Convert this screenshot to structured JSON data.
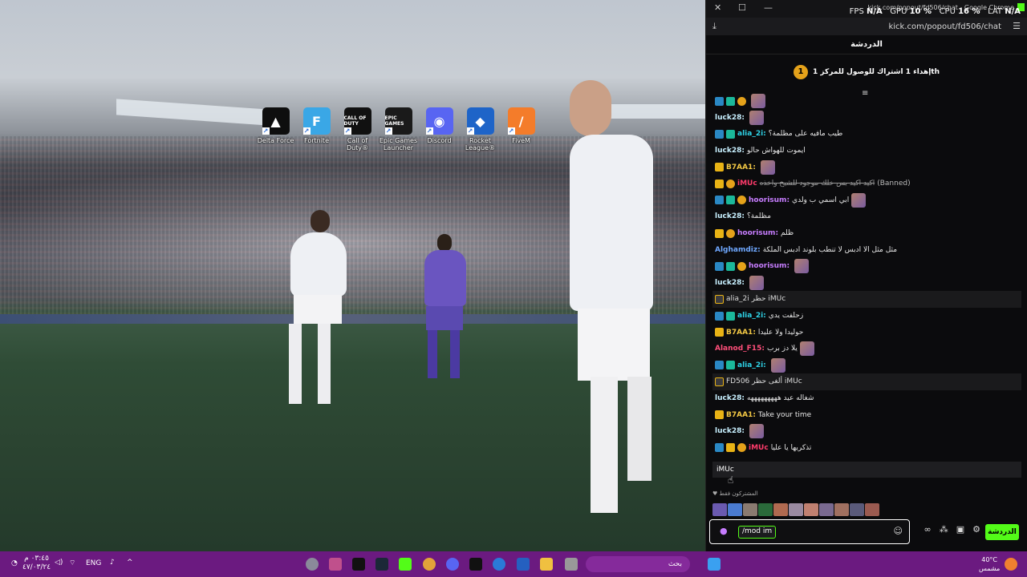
{
  "desktop": {
    "icons": [
      {
        "label": "Delta Force",
        "icon": "delta-force-icon",
        "color": "#0e0e0e",
        "text": "▲"
      },
      {
        "label": "Fortnite",
        "icon": "fortnite-icon",
        "color": "#3aa7e6",
        "text": "F"
      },
      {
        "label": "Call of Duty®",
        "icon": "call-of-duty-icon",
        "color": "#111111",
        "text": "CALL OF DUTY"
      },
      {
        "label": "Epic Games Launcher",
        "icon": "epic-games-icon",
        "color": "#1a1a1a",
        "text": "EPIC GAMES"
      },
      {
        "label": "Discord",
        "icon": "discord-icon",
        "color": "#5865f2",
        "text": "◉"
      },
      {
        "label": "Rocket League®",
        "icon": "rocket-league-icon",
        "color": "#1e64c8",
        "text": "◆"
      },
      {
        "label": "FiveM",
        "icon": "fivem-icon",
        "color": "#f47c2a",
        "text": "/"
      }
    ]
  },
  "browser": {
    "title": "kick.com/popout/fd506/chat - Google Chrome",
    "url": "kick.com/popout/fd506/chat",
    "overlay": {
      "fps_label": "FPS",
      "fps": "N/A",
      "gpu_label": "GPU",
      "gpu": "10 %",
      "cpu_label": "CPU",
      "cpu": "16 %",
      "lat_label": "LAT",
      "lat": "N/A"
    }
  },
  "chat": {
    "header": "الدردشة",
    "pinned": "إهداء 1 اشتراك للوصول للمركز 1th",
    "pinned_badge": "1",
    "messages": [
      {
        "badges": [
          "sub",
          "vip",
          "coin"
        ],
        "user": "",
        "color": "#e8e8e8",
        "text": "",
        "emote": true
      },
      {
        "badges": [],
        "user": "luck28:",
        "color": "#c8f0ff",
        "text": "",
        "emote": true
      },
      {
        "badges": [
          "sub",
          "vip"
        ],
        "user": "alia_2i:",
        "color": "#2ed2e6",
        "text": "طيب مافيه على مظلمة؟"
      },
      {
        "badges": [],
        "user": "luck28:",
        "color": "#c8f0ff",
        "text": "ايموت للهواش حالو"
      },
      {
        "badges": [
          "crown"
        ],
        "user": "B7AA1:",
        "color": "#f2c744",
        "text": "",
        "emote": true
      },
      {
        "badges": [
          "crown",
          "coin"
        ],
        "user": "iMUc",
        "color": "#ff3b6b",
        "text": "اكيد اكيد بس خلك موجود للشيخ واخذه",
        "banned": true,
        "tag": "(Banned)"
      },
      {
        "badges": [
          "sub",
          "vip",
          "coin"
        ],
        "user": "hoorisum:",
        "color": "#c77dff",
        "text": "ابي اسمي ب ولدي",
        "emote": true
      },
      {
        "badges": [],
        "user": "luck28:",
        "color": "#c8f0ff",
        "text": "مظلمة؟"
      },
      {
        "badges": [
          "crown",
          "coin"
        ],
        "user": "hoorisum:",
        "color": "#c77dff",
        "text": "ظلم"
      },
      {
        "badges": [],
        "user": "Alghamdiz:",
        "color": "#6fa8ff",
        "text": "مثل مثل الا ادبس لا تنطب بلوند ادبس الملكة"
      },
      {
        "badges": [
          "sub",
          "vip",
          "coin"
        ],
        "user": "hoorisum:",
        "color": "#c77dff",
        "text": "",
        "emote": true
      },
      {
        "badges": [],
        "user": "luck28:",
        "color": "#c8f0ff",
        "text": "",
        "emote": true
      },
      {
        "system": true,
        "text": "alia_2i حظر iMUc"
      },
      {
        "badges": [
          "sub",
          "vip"
        ],
        "user": "alia_2i:",
        "color": "#2ed2e6",
        "text": "زحلفت يدي"
      },
      {
        "badges": [
          "crown"
        ],
        "user": "B7AA1:",
        "color": "#f2c744",
        "text": "حوليدا ولا عليدا"
      },
      {
        "badges": [],
        "user": "Alanod_F15:",
        "color": "#ff4f7a",
        "text": "يلا دز برب",
        "emote": true
      },
      {
        "badges": [
          "sub",
          "vip"
        ],
        "user": "alia_2i:",
        "color": "#2ed2e6",
        "text": "",
        "emote": true
      },
      {
        "system": true,
        "text": "FD506 ألغى حظر iMUc"
      },
      {
        "badges": [],
        "user": "luck28:",
        "color": "#c8f0ff",
        "text": "شغاله عيد هههههههههه"
      },
      {
        "badges": [
          "crown"
        ],
        "user": "B7AA1:",
        "color": "#f2c744",
        "text": "Take your time"
      },
      {
        "badges": [],
        "user": "luck28:",
        "color": "#c8f0ff",
        "text": "",
        "emote": true
      },
      {
        "badges": [
          "sub",
          "crown",
          "coin"
        ],
        "user": "iMUc",
        "color": "#ff3b6b",
        "text": "تذكريها يا عليا"
      }
    ],
    "suggestion": "iMUc",
    "subscribers_label": "المشتركون فقط",
    "input_value": "/mod im",
    "send_label": "الدردشة"
  },
  "taskbar": {
    "time": "٠٣:٤٥ م",
    "date": "٤٧/٠٣/٢٤",
    "lang": "ENG",
    "search_placeholder": "بحث",
    "temp": "40°C",
    "weather": "مشمس"
  }
}
